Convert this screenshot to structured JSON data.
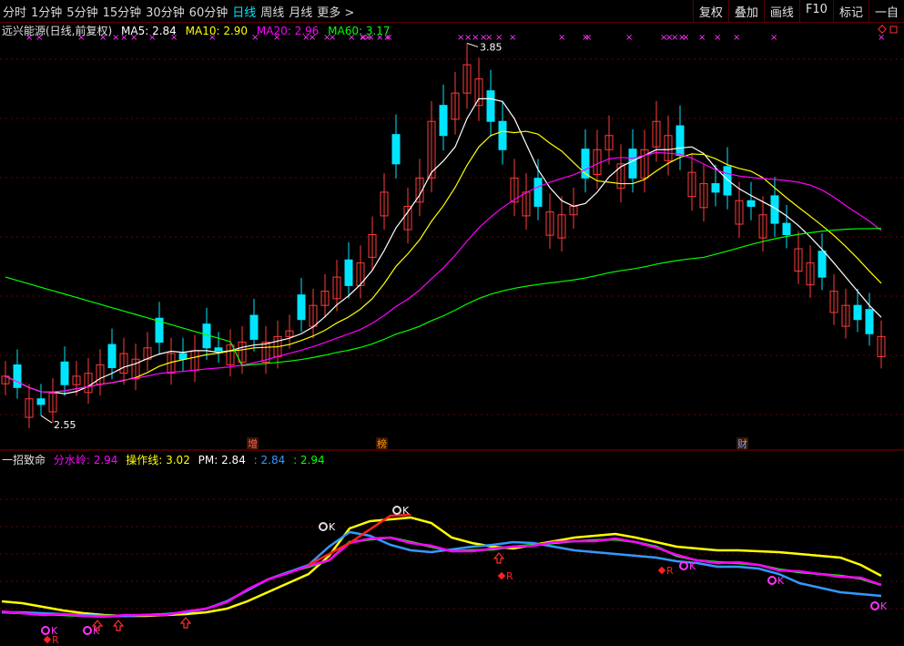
{
  "toolbar": {
    "periods": [
      "分时",
      "1分钟",
      "5分钟",
      "15分钟",
      "30分钟",
      "60分钟",
      "日线",
      "周线",
      "月线",
      "更多 >"
    ],
    "active_period": "日线",
    "right_buttons": [
      "复权",
      "叠加",
      "画线",
      "F10",
      "标记",
      "一自"
    ]
  },
  "stock": {
    "name": "远兴能源(日线,前复权)",
    "ma": [
      {
        "label": "MA5: 2.84",
        "color": "#ffffff"
      },
      {
        "label": "MA10: 2.90",
        "color": "#ffff00"
      },
      {
        "label": "MA20: 2.96",
        "color": "#ff00ff"
      },
      {
        "label": "MA60: 3.17",
        "color": "#00ff00"
      }
    ]
  },
  "price_labels": {
    "high": "3.85",
    "low": "2.55"
  },
  "event_markers": [
    {
      "text": "增",
      "color": "#ff6060"
    },
    {
      "text": "榜",
      "color": "#ff9900"
    },
    {
      "text": "财",
      "color": "#66aaff"
    }
  ],
  "indicator": {
    "name": "一招致命",
    "items": [
      {
        "label": "分水岭: 2.94",
        "color": "#ff00ff"
      },
      {
        "label": "操作线: 3.02",
        "color": "#ffff00"
      },
      {
        "label": "PM: 2.84",
        "color": "#ffffff"
      },
      {
        "label": ": 2.84",
        "color": "#3399ff"
      },
      {
        "label": ": 2.94",
        "color": "#00ff00"
      }
    ]
  },
  "signals": {
    "k_label": "K",
    "r_label": "R"
  },
  "colors": {
    "up": "#ff3b3b",
    "down": "#00e5ff",
    "ma5": "#ffffff",
    "ma10": "#ffff00",
    "ma20": "#ff00ff",
    "ma60": "#00ff00",
    "grid": "#6a0000"
  },
  "chart_data": {
    "type": "candlestick",
    "price_range": [
      2.5,
      3.9
    ],
    "close": [
      2.7,
      2.66,
      2.62,
      2.6,
      2.64,
      2.67,
      2.7,
      2.71,
      2.74,
      2.73,
      2.78,
      2.76,
      2.8,
      2.82,
      2.78,
      2.76,
      2.79,
      2.8,
      2.79,
      2.81,
      2.82,
      2.83,
      2.82,
      2.84,
      2.86,
      2.9,
      2.95,
      3.0,
      3.05,
      3.02,
      3.1,
      3.2,
      3.35,
      3.45,
      3.3,
      3.4,
      3.6,
      3.55,
      3.7,
      3.8,
      3.75,
      3.6,
      3.5,
      3.4,
      3.35,
      3.3,
      3.28,
      3.27,
      3.3,
      3.4,
      3.5,
      3.55,
      3.45,
      3.4,
      3.5,
      3.6,
      3.55,
      3.48,
      3.42,
      3.38,
      3.35,
      3.34,
      3.32,
      3.3,
      3.27,
      3.24,
      3.2,
      3.15,
      3.1,
      3.05,
      3.0,
      2.95,
      2.9,
      2.85,
      2.84
    ]
  }
}
